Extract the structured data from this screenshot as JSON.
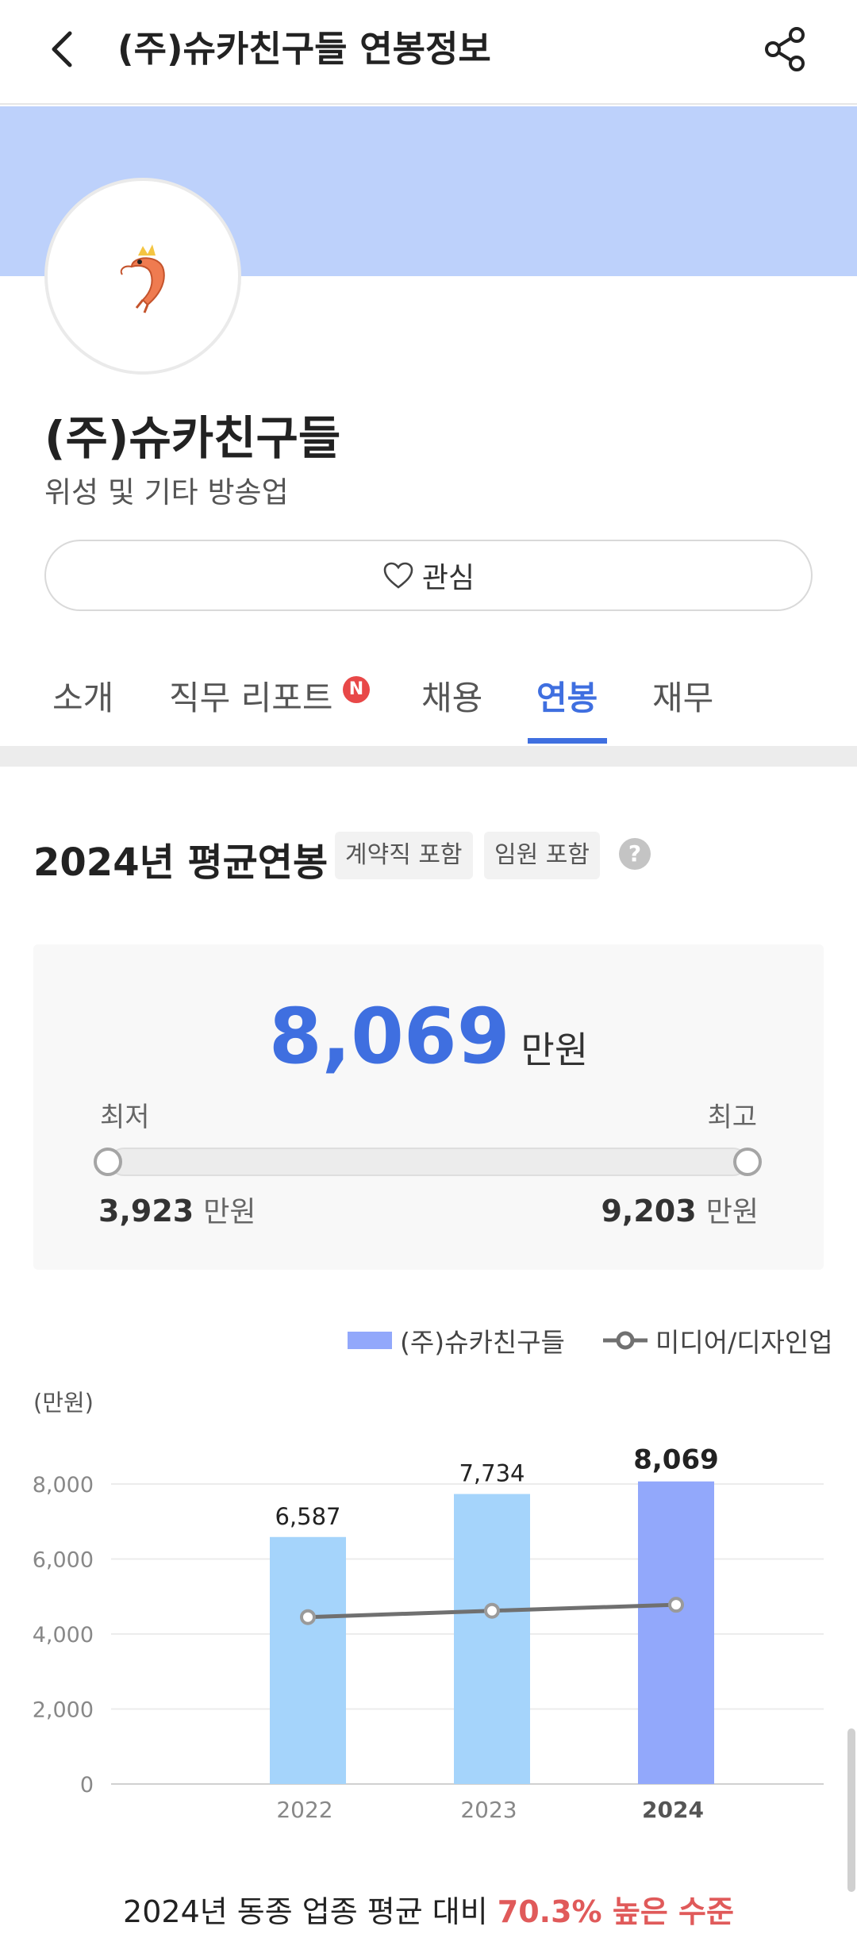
{
  "header": {
    "title": "(주)슈카친구들 연봉정보"
  },
  "company": {
    "name": "(주)슈카친구들",
    "industry": "위성 및 기타 방송업",
    "interest_label": "관심"
  },
  "tabs": [
    {
      "label": "소개"
    },
    {
      "label": "직무 리포트",
      "badge": "N"
    },
    {
      "label": "채용"
    },
    {
      "label": "연봉"
    },
    {
      "label": "재무"
    }
  ],
  "active_tab": "연봉",
  "salary": {
    "title": "2024년 평균연봉",
    "chips": [
      "계약직 포함",
      "임원 포함"
    ],
    "help": "?",
    "average": "8,069",
    "unit": "만원",
    "min_label": "최저",
    "max_label": "최고",
    "min_value": "3,923",
    "max_value": "9,203"
  },
  "legend": {
    "company": "(주)슈카친구들",
    "industry": "미디어/디자인업"
  },
  "colors": {
    "accent": "#3f6fe0",
    "bar_past": "#a5d4fb",
    "bar_current": "#92a8fb",
    "line": "#707070",
    "highlight": "#e05a5a",
    "banner": "#bdd1fb"
  },
  "chart_data": {
    "type": "bar",
    "unit_label": "(만원)",
    "categories": [
      "2022",
      "2023",
      "2024"
    ],
    "series": [
      {
        "name": "(주)슈카친구들",
        "type": "bar",
        "values": [
          6587,
          7734,
          8069
        ],
        "labels": [
          "6,587",
          "7,734",
          "8,069"
        ]
      },
      {
        "name": "미디어/디자인업",
        "type": "line",
        "values": [
          4450,
          4620,
          4780
        ]
      }
    ],
    "yticks": [
      "8,000",
      "6,000",
      "4,000",
      "2,000",
      "0"
    ],
    "ytick_values": [
      8000,
      6000,
      4000,
      2000,
      0
    ],
    "ylim": [
      0,
      8000
    ],
    "grid": true,
    "legend": "top-right"
  },
  "comparison": {
    "prefix": "2024년 동종 업종 평균 대비 ",
    "highlight": "70.3% 높은 수준"
  }
}
